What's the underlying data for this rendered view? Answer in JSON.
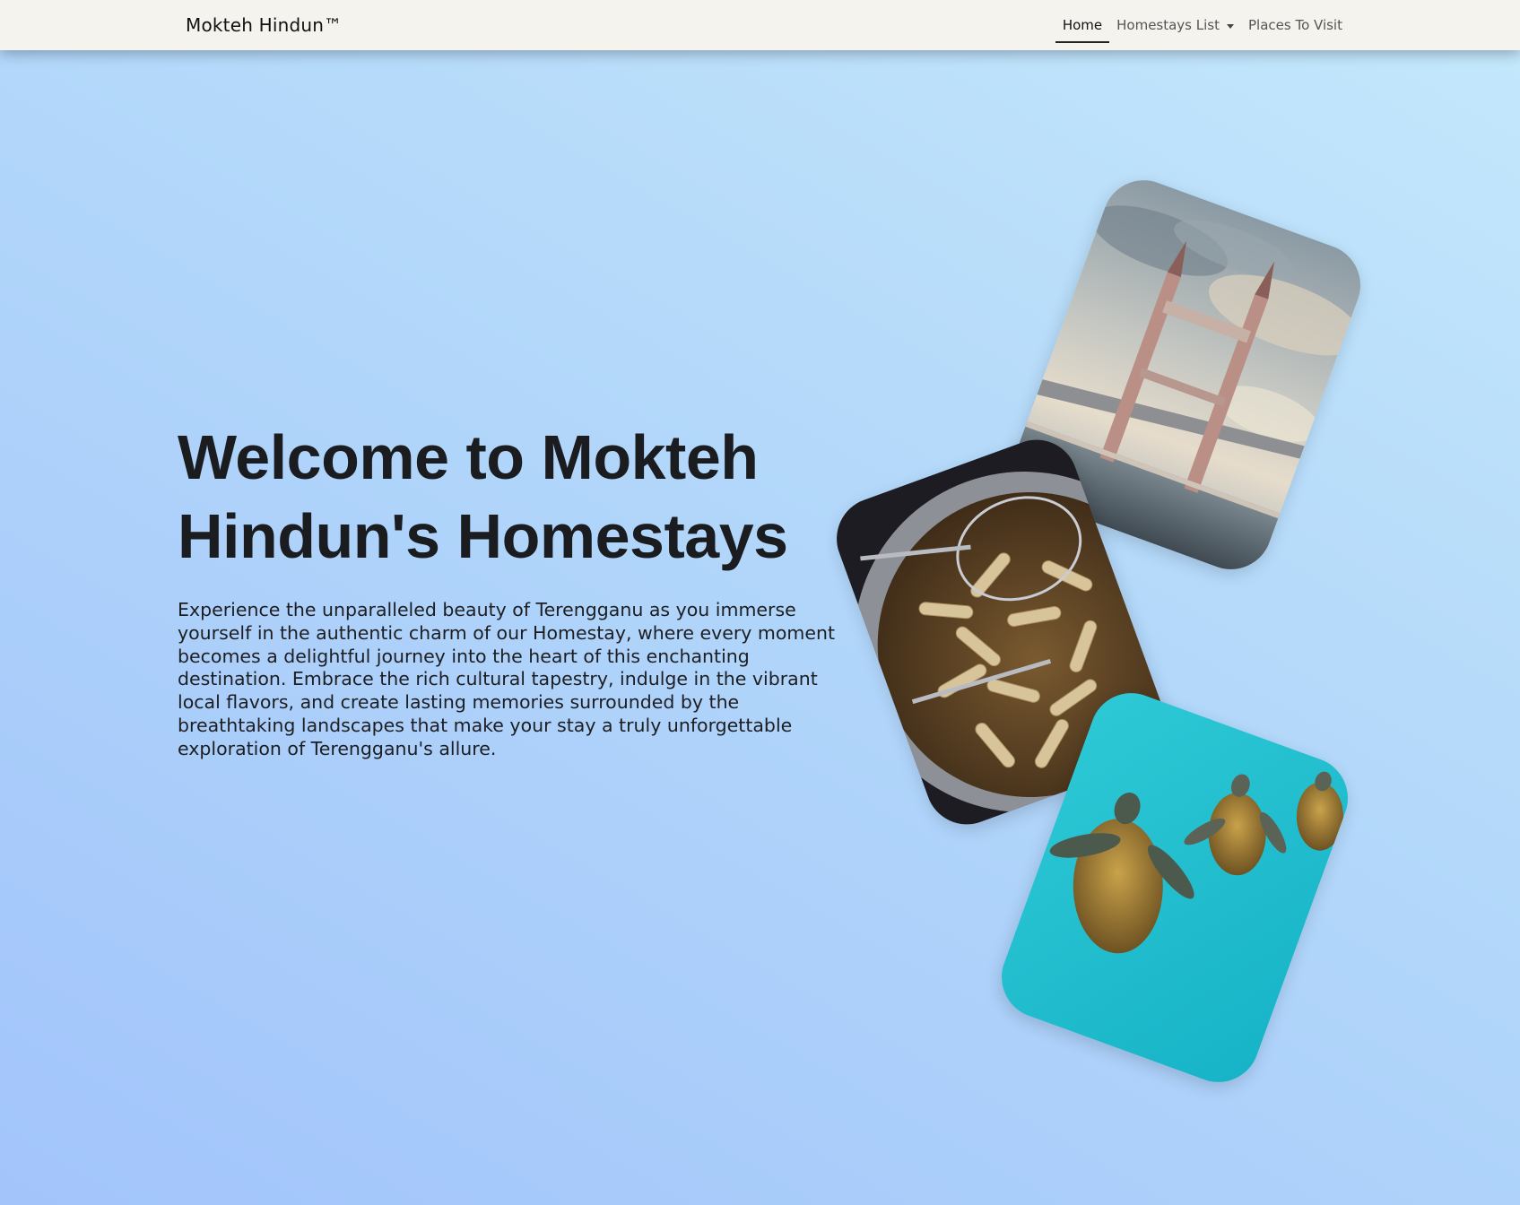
{
  "navbar": {
    "brand": "Mokteh Hindun™",
    "links": [
      {
        "label": "Home",
        "active": true
      },
      {
        "label": "Homestays List",
        "dropdown": true
      },
      {
        "label": "Places To Visit"
      }
    ]
  },
  "hero": {
    "title": "Welcome to Mokteh Hindun's Homestays",
    "description": "Experience the unparalleled beauty of Terengganu as you immerse yourself in the authentic charm of our Homestay, where every moment becomes a delightful journey into the heart of this enchanting destination. Embrace the rich cultural tapestry, indulge in the vibrant local flavors, and create lasting memories surrounded by the breathtaking landscapes that make your stay a truly unforgettable exploration of Terengganu's allure."
  },
  "gallery": [
    {
      "icon": "drawbridge-photo"
    },
    {
      "icon": "keropok-frying-photo"
    },
    {
      "icon": "sea-turtles-photo"
    }
  ],
  "colors": {
    "navbar_bg": "#f5f3ee",
    "text_dark": "#1b1c1f",
    "bg_gradient_start": "#a2c4fb",
    "bg_gradient_end": "#c4e8fb"
  }
}
